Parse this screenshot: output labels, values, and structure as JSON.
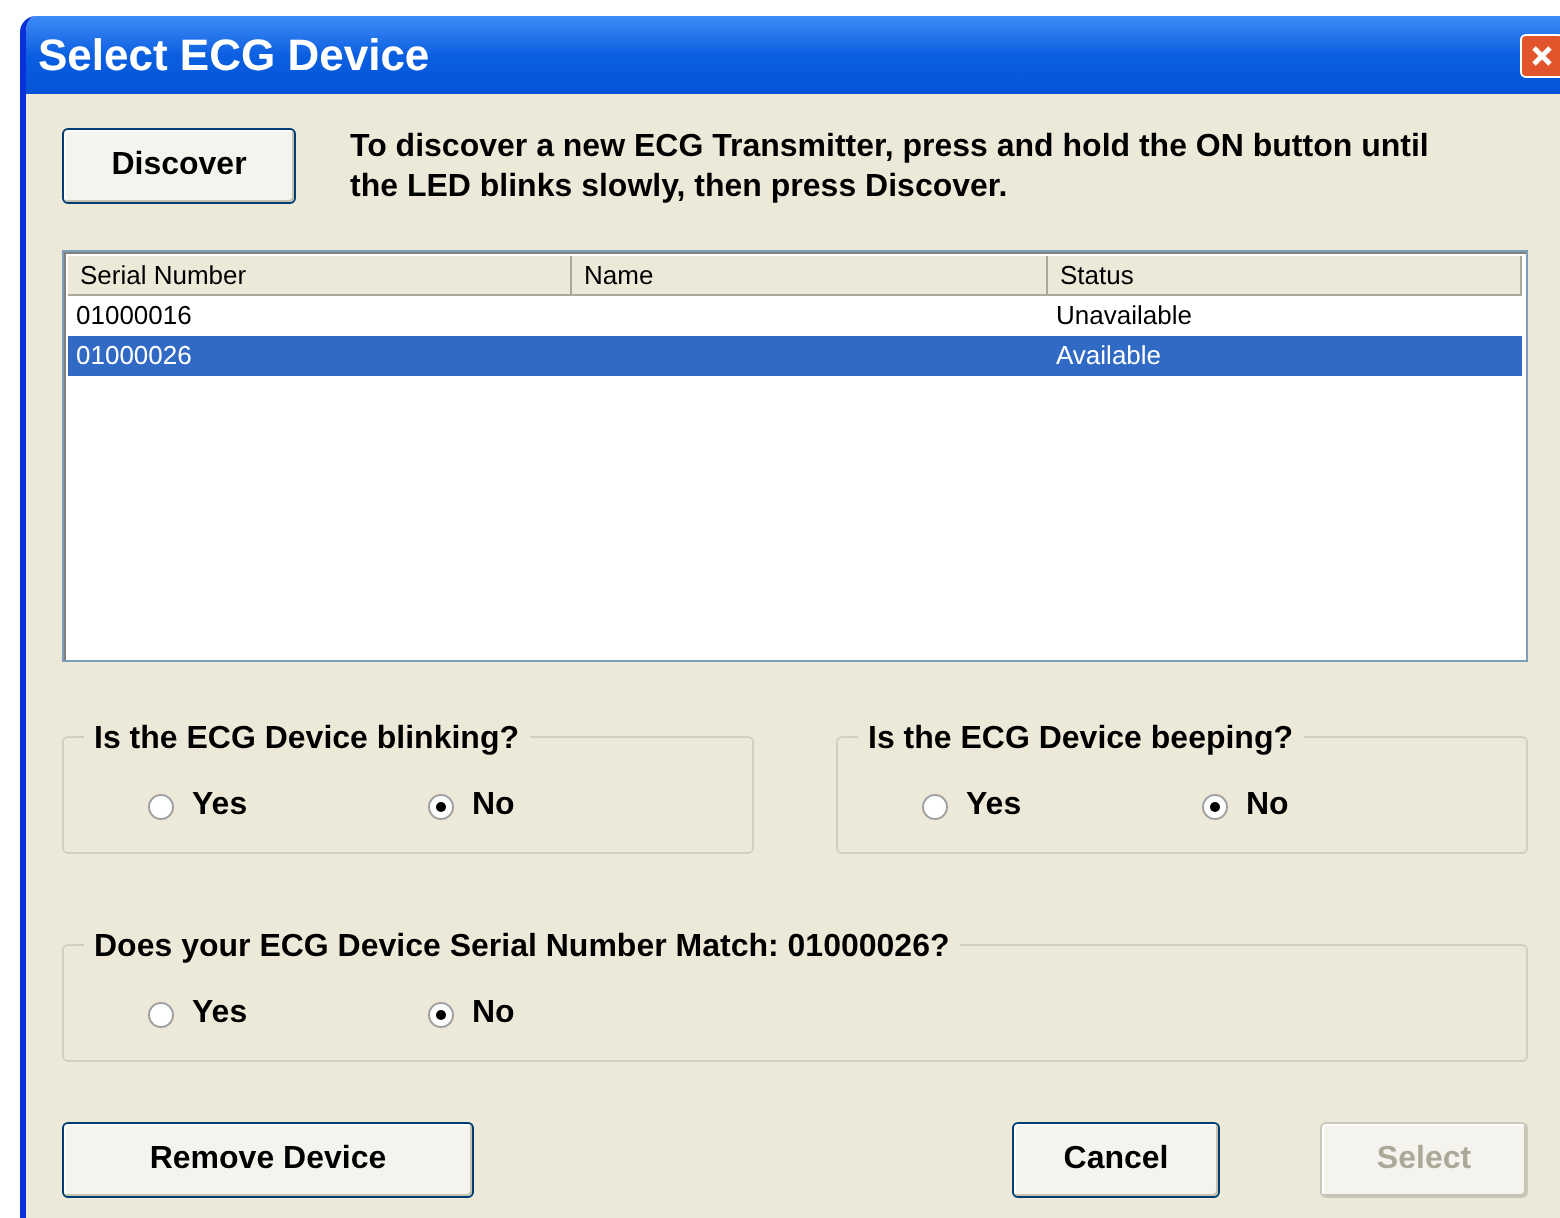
{
  "window": {
    "title": "Select ECG Device"
  },
  "discover_button": "Discover",
  "instructions": "To discover a new ECG Transmitter, press and hold the ON button until the LED blinks slowly, then press Discover.",
  "device_list": {
    "columns": [
      "Serial Number",
      "Name",
      "Status"
    ],
    "rows": [
      {
        "serial_number": "01000016",
        "status": "Unavailable",
        "selected": false
      },
      {
        "serial_number": "01000026",
        "status": "Available",
        "selected": true
      }
    ]
  },
  "questions": [
    {
      "label": "Is the ECG Device blinking?",
      "options": [
        {
          "label": "Yes",
          "selected": false
        },
        {
          "label": "No",
          "selected": true
        }
      ]
    },
    {
      "label": "Is the ECG Device beeping?",
      "options": [
        {
          "label": "Yes",
          "selected": false
        },
        {
          "label": "No",
          "selected": true
        }
      ]
    },
    {
      "label": "Does your ECG Device Serial Number Match: 01000026?",
      "options": [
        {
          "label": "Yes",
          "selected": false
        },
        {
          "label": "No",
          "selected": true
        }
      ]
    }
  ],
  "buttons": [
    {
      "label": "Remove Device",
      "disabled": false
    },
    {
      "label": "Cancel",
      "disabled": false
    },
    {
      "label": "Select",
      "disabled": true
    }
  ]
}
